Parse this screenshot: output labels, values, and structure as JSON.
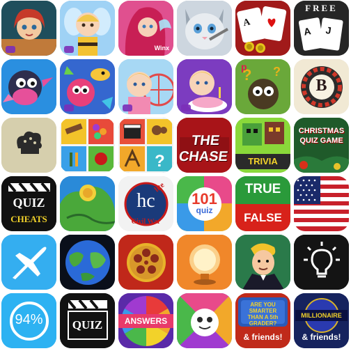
{
  "icons": [
    {
      "id": "r1c1",
      "name": "cartoon girl game",
      "text": ""
    },
    {
      "id": "r1c2",
      "name": "baby bee game",
      "text": ""
    },
    {
      "id": "r1c3",
      "name": "fairy winx",
      "text": "Winx"
    },
    {
      "id": "r1c4",
      "name": "kitten salon",
      "text": ""
    },
    {
      "id": "r1c5",
      "name": "poker cards",
      "text": ""
    },
    {
      "id": "r1c6",
      "name": "free solitaire",
      "text": "FREE"
    },
    {
      "id": "r2c1",
      "name": "bird cartoon",
      "text": ""
    },
    {
      "id": "r2c2",
      "name": "fish cartoon",
      "text": ""
    },
    {
      "id": "r2c3",
      "name": "baby ferris wheel",
      "text": ""
    },
    {
      "id": "r2c4",
      "name": "baby cake",
      "text": ""
    },
    {
      "id": "r2c5",
      "name": "quiz owl",
      "text": ""
    },
    {
      "id": "r2c6",
      "name": "roulette B",
      "text": "B"
    },
    {
      "id": "r3c1",
      "name": "chef hat",
      "text": ""
    },
    {
      "id": "r3c2",
      "name": "pixel objects quiz",
      "text": ""
    },
    {
      "id": "r3c3",
      "name": "movie quiz collage",
      "text": ""
    },
    {
      "id": "r3c4",
      "name": "the chase",
      "text": "THE CHASE"
    },
    {
      "id": "r3c5",
      "name": "block trivia",
      "text": "TRIVIA"
    },
    {
      "id": "r3c6",
      "name": "christmas quiz game",
      "text": "CHRISTMAS QUIZ GAME"
    },
    {
      "id": "r4c1",
      "name": "quiz cheats",
      "text": "QUIZ",
      "text2": "CHEATS"
    },
    {
      "id": "r4c2",
      "name": "globe map",
      "text": ""
    },
    {
      "id": "r4c3",
      "name": "hc lite civil war",
      "text": "hc",
      "text2": "lite",
      "text3": "Civil War"
    },
    {
      "id": "r4c4",
      "name": "101 quiz",
      "text": "101",
      "text2": "quiz"
    },
    {
      "id": "r4c5",
      "name": "true false",
      "text": "TRUE",
      "text2": "FALSE"
    },
    {
      "id": "r4c6",
      "name": "usa flag",
      "text": ""
    },
    {
      "id": "r5c1",
      "name": "airplane",
      "text": ""
    },
    {
      "id": "r5c2",
      "name": "earth globe",
      "text": ""
    },
    {
      "id": "r5c3",
      "name": "film reel",
      "text": ""
    },
    {
      "id": "r5c4",
      "name": "orange lamp",
      "text": ""
    },
    {
      "id": "r5c5",
      "name": "game show host",
      "text": ""
    },
    {
      "id": "r5c6",
      "name": "light bulb",
      "text": ""
    },
    {
      "id": "r6c1",
      "name": "94 percent",
      "text": "94%"
    },
    {
      "id": "r6c2",
      "name": "quiz clapper",
      "text": "QUIZ"
    },
    {
      "id": "r6c3",
      "name": "answers wheel",
      "text": "ANSWERS"
    },
    {
      "id": "r6c4",
      "name": "trivia crack",
      "text": ""
    },
    {
      "id": "r6c5",
      "name": "are you smarter",
      "text": "ARE YOU SMARTER THAN A 5th GRADER?",
      "text2": "& friends!"
    },
    {
      "id": "r6c6",
      "name": "millionaire",
      "text": "MILLIONAIRE",
      "text2": "& friends!"
    }
  ]
}
